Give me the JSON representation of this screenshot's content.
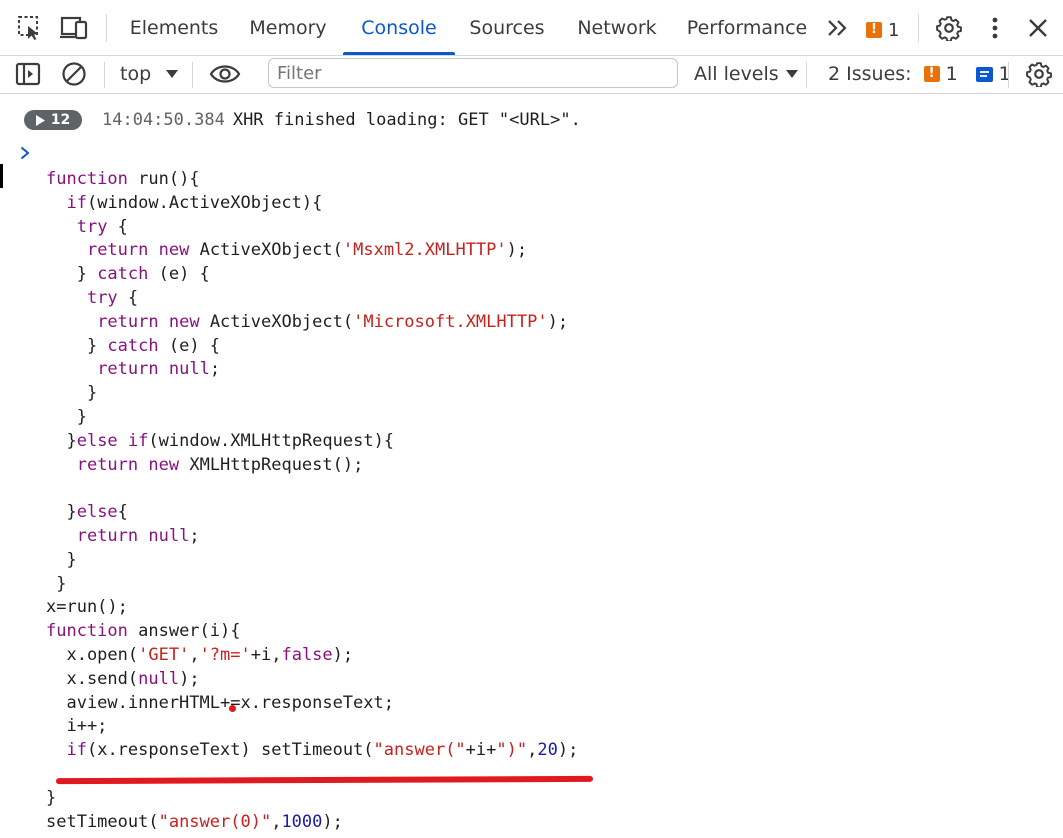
{
  "tabs": [
    {
      "label": "Elements"
    },
    {
      "label": "Memory"
    },
    {
      "label": "Console",
      "active": true
    },
    {
      "label": "Sources"
    },
    {
      "label": "Network"
    },
    {
      "label": "Performance"
    }
  ],
  "overflow": {
    "label": "»"
  },
  "warnings_count": "1",
  "toolbar": {
    "context": "top",
    "filter_placeholder": "Filter",
    "levels": "All levels",
    "issues_label": "2 Issues:",
    "issues_warn_count": "1",
    "issues_info_count": "1"
  },
  "console": {
    "group_count": "12",
    "timestamp": "14:04:50.384",
    "message": "XHR finished loading: GET \"<URL>\".",
    "prompt": ">"
  },
  "code_lines": [
    "function run(){",
    "  if(window.ActiveXObject){",
    "   try {",
    "    return new ActiveXObject('Msxml2.XMLHTTP');",
    "   } catch (e) {",
    "    try {",
    "     return new ActiveXObject('Microsoft.XMLHTTP');",
    "    } catch (e) {",
    "     return null;",
    "    }",
    "   }",
    "  }else if(window.XMLHttpRequest){",
    "   return new XMLHttpRequest();",
    "",
    "  }else{",
    "   return null;",
    "  }",
    " }",
    "x=run();",
    "function answer(i){",
    "  x.open('GET','?m='+i,false);",
    "  x.send(null);",
    "  aview.innerHTML+=x.responseText;",
    "  i++;",
    "  if(x.responseText) setTimeout(\"answer(\"+i+\")\",20);",
    "",
    "}",
    "setTimeout(\"answer(0)\",1000);"
  ],
  "colors": {
    "accent": "#0b57d0",
    "warning": "#e8710a",
    "annotation": "#e0191d"
  }
}
